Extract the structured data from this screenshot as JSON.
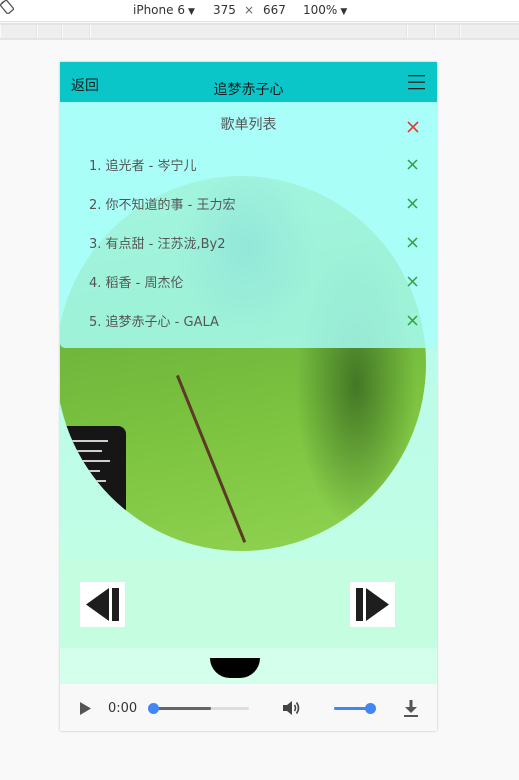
{
  "devtools": {
    "device": "iPhone 6",
    "width": "375",
    "times": "×",
    "height": "667",
    "zoom": "100%",
    "icons": {
      "dropdown": "triangle-down",
      "rotate": "rotate-icon"
    }
  },
  "header": {
    "back_label": "返回",
    "title": "追梦赤子心",
    "menu_icon": "hamburger-menu-icon"
  },
  "playlist": {
    "title": "歌单列表",
    "close_icon_color": "#e53935",
    "delete_icon_color": "#2e9e3e",
    "songs": [
      {
        "label": "1. 追光者 - 岑宁儿"
      },
      {
        "label": "2. 你不知道的事 - 王力宏"
      },
      {
        "label": "3. 有点甜 - 汪苏泷,By2"
      },
      {
        "label": "4. 稻香 - 周杰伦"
      },
      {
        "label": "5. 追梦赤子心 - GALA"
      }
    ]
  },
  "controls": {
    "prev_icon": "previous-track-icon",
    "next_icon": "next-track-icon"
  },
  "audio": {
    "time": "0:00",
    "seek_progress": 0.0,
    "buffered": 0.6,
    "volume": 1.0,
    "accent_color": "#4285f4"
  },
  "colors": {
    "header": "#0bc6c9",
    "overlay": "#a8fffa",
    "controls_bg": "#c4fde0"
  }
}
